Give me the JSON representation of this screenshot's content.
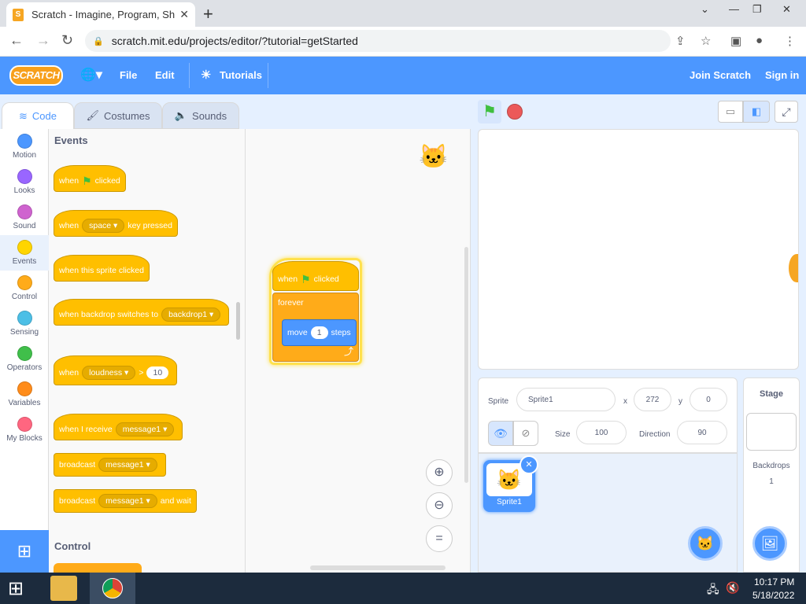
{
  "browser": {
    "tab_title": "Scratch - Imagine, Program, Shar",
    "tab_close": "✕",
    "new_tab": "+",
    "url": "scratch.mit.edu/projects/editor/?tutorial=getStarted"
  },
  "menu": {
    "logo": "SCRATCH",
    "file": "File",
    "edit": "Edit",
    "tutorials": "Tutorials",
    "join": "Join Scratch",
    "signin": "Sign in"
  },
  "tabs": {
    "code": "Code",
    "costumes": "Costumes",
    "sounds": "Sounds"
  },
  "categories": [
    {
      "label": "Motion",
      "color": "#4c97ff"
    },
    {
      "label": "Looks",
      "color": "#9966ff"
    },
    {
      "label": "Sound",
      "color": "#cf63cf"
    },
    {
      "label": "Events",
      "color": "#ffd500"
    },
    {
      "label": "Control",
      "color": "#ffab19"
    },
    {
      "label": "Sensing",
      "color": "#4cbfe6"
    },
    {
      "label": "Operators",
      "color": "#40bf4a"
    },
    {
      "label": "Variables",
      "color": "#ff8c1a"
    },
    {
      "label": "My Blocks",
      "color": "#ff6680"
    }
  ],
  "palette": {
    "events_heading": "Events",
    "control_heading": "Control",
    "b1_when": "when",
    "b1_clicked": "clicked",
    "b2_when": "when",
    "b2_key": "space",
    "b2_pressed": "key pressed",
    "b3": "when this sprite clicked",
    "b4_text": "when backdrop switches to",
    "b4_dd": "backdrop1",
    "b5_when": "when",
    "b5_dd": "loudness",
    "b5_gt": ">",
    "b5_val": "10",
    "b6_text": "when I receive",
    "b6_dd": "message1",
    "b7_text": "broadcast",
    "b7_dd": "message1",
    "b8_text": "broadcast",
    "b8_dd": "message1",
    "b8_wait": "and wait"
  },
  "script": {
    "hat_when": "when",
    "hat_clicked": "clicked",
    "forever": "forever",
    "move": "move",
    "move_val": "1",
    "steps": "steps"
  },
  "sprite_info": {
    "sprite_label": "Sprite",
    "sprite_name": "Sprite1",
    "x_label": "x",
    "x_val": "272",
    "y_label": "y",
    "y_val": "0",
    "size_label": "Size",
    "size_val": "100",
    "direction_label": "Direction",
    "direction_val": "90"
  },
  "sprite_list": [
    {
      "name": "Sprite1"
    }
  ],
  "stage_pane": {
    "title": "Stage",
    "backdrops_label": "Backdrops",
    "backdrops_count": "1"
  },
  "taskbar": {
    "time": "10:17 PM",
    "date": "5/18/2022"
  }
}
